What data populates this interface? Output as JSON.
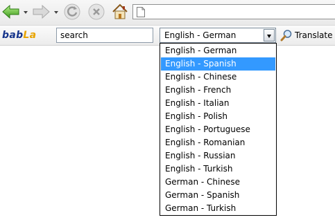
{
  "nav": {
    "back_icon": "back-arrow-icon",
    "forward_icon": "forward-arrow-icon",
    "refresh_icon": "refresh-icon",
    "stop_icon": "stop-icon",
    "home_icon": "home-icon",
    "address_value": ""
  },
  "toolbar": {
    "logo_part1": "bab",
    "logo_part2": "La",
    "search_value": "search",
    "selected_language": "English - German",
    "translate_label": "Translate",
    "brand_color": "#16358c",
    "accent_color": "#e8a400"
  },
  "dropdown": {
    "highlight_color": "#3399ff",
    "highlighted_index": 1,
    "options": [
      "English - German",
      "English - Spanish",
      "English - Chinese",
      "English - French",
      "English - Italian",
      "English - Polish",
      "English - Portuguese",
      "English - Romanian",
      "English - Russian",
      "English - Turkish",
      "German - Chinese",
      "German - Spanish",
      "German - Turkish"
    ]
  }
}
